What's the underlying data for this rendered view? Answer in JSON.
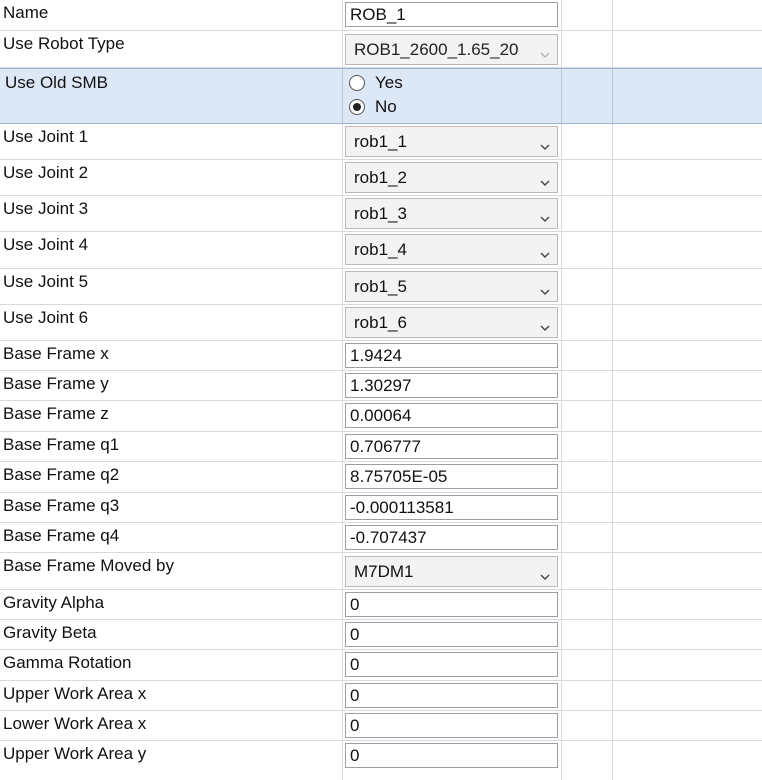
{
  "properties": {
    "name": {
      "label": "Name",
      "value": "ROB_1"
    },
    "robot_type": {
      "label": "Use Robot Type",
      "value": "ROB1_2600_1.65_20"
    },
    "old_smb": {
      "label": "Use Old SMB",
      "options": [
        "Yes",
        "No"
      ],
      "selected": "No"
    },
    "joints": [
      {
        "label": "Use Joint 1",
        "value": "rob1_1"
      },
      {
        "label": "Use Joint 2",
        "value": "rob1_2"
      },
      {
        "label": "Use Joint 3",
        "value": "rob1_3"
      },
      {
        "label": "Use Joint 4",
        "value": "rob1_4"
      },
      {
        "label": "Use Joint 5",
        "value": "rob1_5"
      },
      {
        "label": "Use Joint 6",
        "value": "rob1_6"
      }
    ],
    "base_frame": [
      {
        "label": "Base Frame x",
        "value": "1.9424"
      },
      {
        "label": "Base Frame y",
        "value": "1.30297"
      },
      {
        "label": "Base Frame z",
        "value": "0.00064"
      },
      {
        "label": "Base Frame q1",
        "value": "0.706777"
      },
      {
        "label": "Base Frame q2",
        "value": "8.75705E-05"
      },
      {
        "label": "Base Frame q3",
        "value": "-0.000113581"
      },
      {
        "label": "Base Frame q4",
        "value": "-0.707437"
      }
    ],
    "moved_by": {
      "label": "Base Frame Moved by",
      "value": "M7DM1"
    },
    "misc": [
      {
        "label": "Gravity Alpha",
        "value": "0"
      },
      {
        "label": "Gravity Beta",
        "value": "0"
      },
      {
        "label": "Gamma Rotation",
        "value": "0"
      },
      {
        "label": "Upper Work Area x",
        "value": "0"
      },
      {
        "label": "Lower Work Area x",
        "value": "0"
      },
      {
        "label": "Upper Work Area y",
        "value": "0"
      }
    ]
  },
  "icons": {
    "dropdown": "chevron-down-icon",
    "radio": "radio-button-icon"
  },
  "colors": {
    "selected_row": "#dde8f7",
    "grid_line": "#d9d9d9"
  }
}
